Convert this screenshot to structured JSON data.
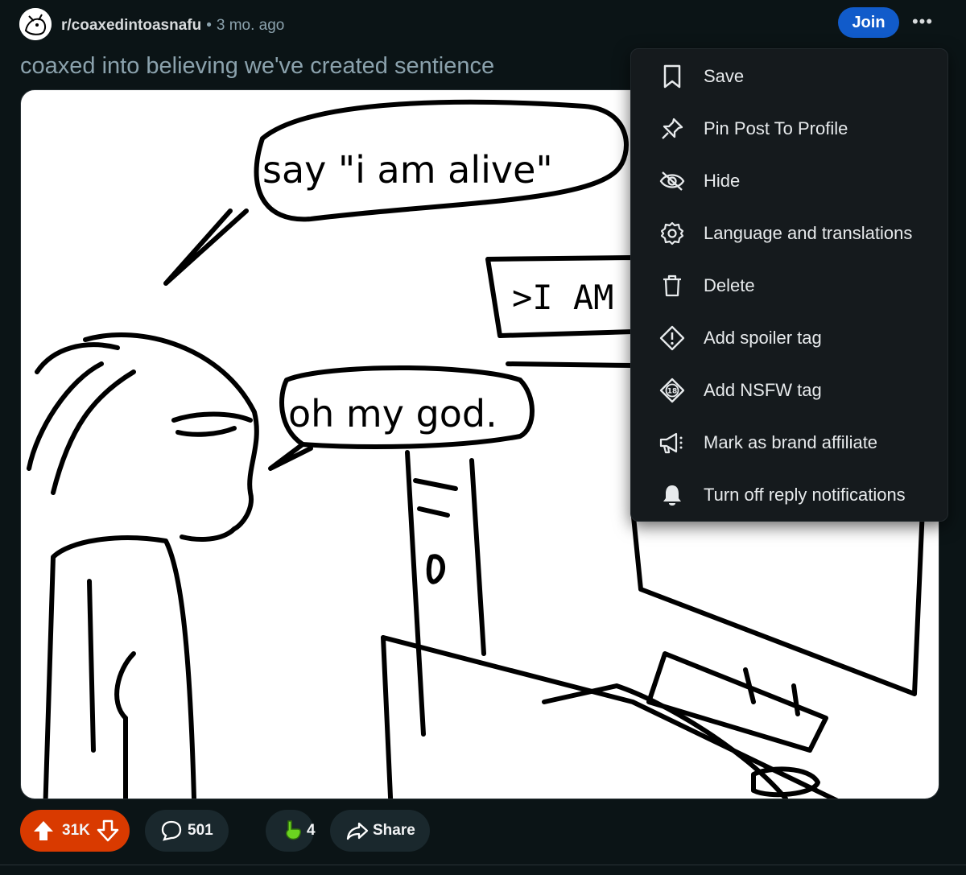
{
  "post": {
    "subreddit": "r/coaxedintoasnafu",
    "separator": "•",
    "age": "3 mo. ago",
    "join_label": "Join",
    "more_label": "•••",
    "title": "coaxed into believing we've created sentience"
  },
  "comic": {
    "bubble1": "say \"i am alive\"",
    "screen_text": ">I AM",
    "bubble2": "oh my god."
  },
  "actions": {
    "upvotes": "31K",
    "comments": "501",
    "awards": "4",
    "share_label": "Share"
  },
  "menu": {
    "items": [
      {
        "label": "Save",
        "icon": "bookmark-icon"
      },
      {
        "label": "Pin Post To Profile",
        "icon": "pin-icon"
      },
      {
        "label": "Hide",
        "icon": "hide-eye-icon"
      },
      {
        "label": "Language and translations",
        "icon": "gear-icon"
      },
      {
        "label": "Delete",
        "icon": "trash-icon"
      },
      {
        "label": "Add spoiler tag",
        "icon": "spoiler-icon"
      },
      {
        "label": "Add NSFW tag",
        "icon": "nsfw-18-icon"
      },
      {
        "label": "Mark as brand affiliate",
        "icon": "megaphone-icon"
      },
      {
        "label": "Turn off reply notifications",
        "icon": "bell-icon"
      }
    ]
  },
  "colors": {
    "background": "#0b1416",
    "join": "#115bca",
    "upvote": "#d93a00",
    "menu_bg": "#151a1d"
  }
}
